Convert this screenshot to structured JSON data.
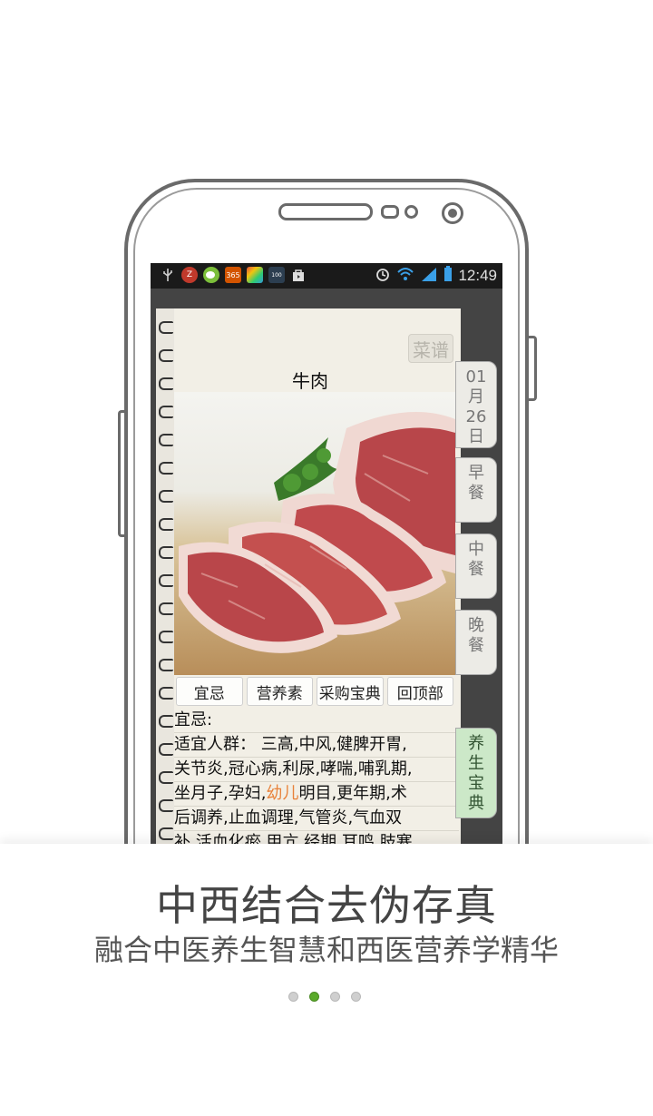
{
  "status_bar": {
    "time": "12:49",
    "icons": [
      "usb-icon",
      "zhihu-icon",
      "wechat-icon",
      "calendar-365-icon",
      "photo-icon",
      "battery-small-icon",
      "bag-icon"
    ],
    "right_icons": [
      "alarm-icon",
      "wifi-icon",
      "signal-icon",
      "battery-icon"
    ],
    "icon_texts": {
      "z": "Z",
      "365": "365",
      "100": "100"
    }
  },
  "recipe": {
    "corner_label": "菜谱",
    "title": "牛肉",
    "tabs": [
      "宜忌",
      "营养素",
      "采购宝典",
      "回顶部"
    ],
    "section_label": "宜忌:",
    "lines": [
      "适宜人群： 三高,中风,健脾开胃,",
      "关节炎,冠心病,利尿,哮喘,哺乳期,",
      "坐月子,孕妇,",
      "明目,更年期,术",
      "后调养,止血调理,气管炎,气血双",
      "补,活血化瘀,甲亢,经期,耳鸣,肢寒"
    ],
    "highlight_word": "幼儿"
  },
  "side_tabs": {
    "date": [
      "01",
      "月",
      "26",
      "日"
    ],
    "breakfast": [
      "早",
      "餐"
    ],
    "lunch": [
      "中",
      "餐"
    ],
    "dinner": [
      "晚",
      "餐"
    ],
    "health": [
      "养",
      "生",
      "宝",
      "典"
    ]
  },
  "banner": {
    "headline": "中西结合去伪存真",
    "subline": "融合中医养生智慧和西医营养学精华"
  },
  "pager": {
    "count": 4,
    "active_index": 1
  },
  "colors": {
    "highlight": "#e8823a",
    "active_dot": "#5aaa2a",
    "active_tab": "#cce8c8"
  }
}
